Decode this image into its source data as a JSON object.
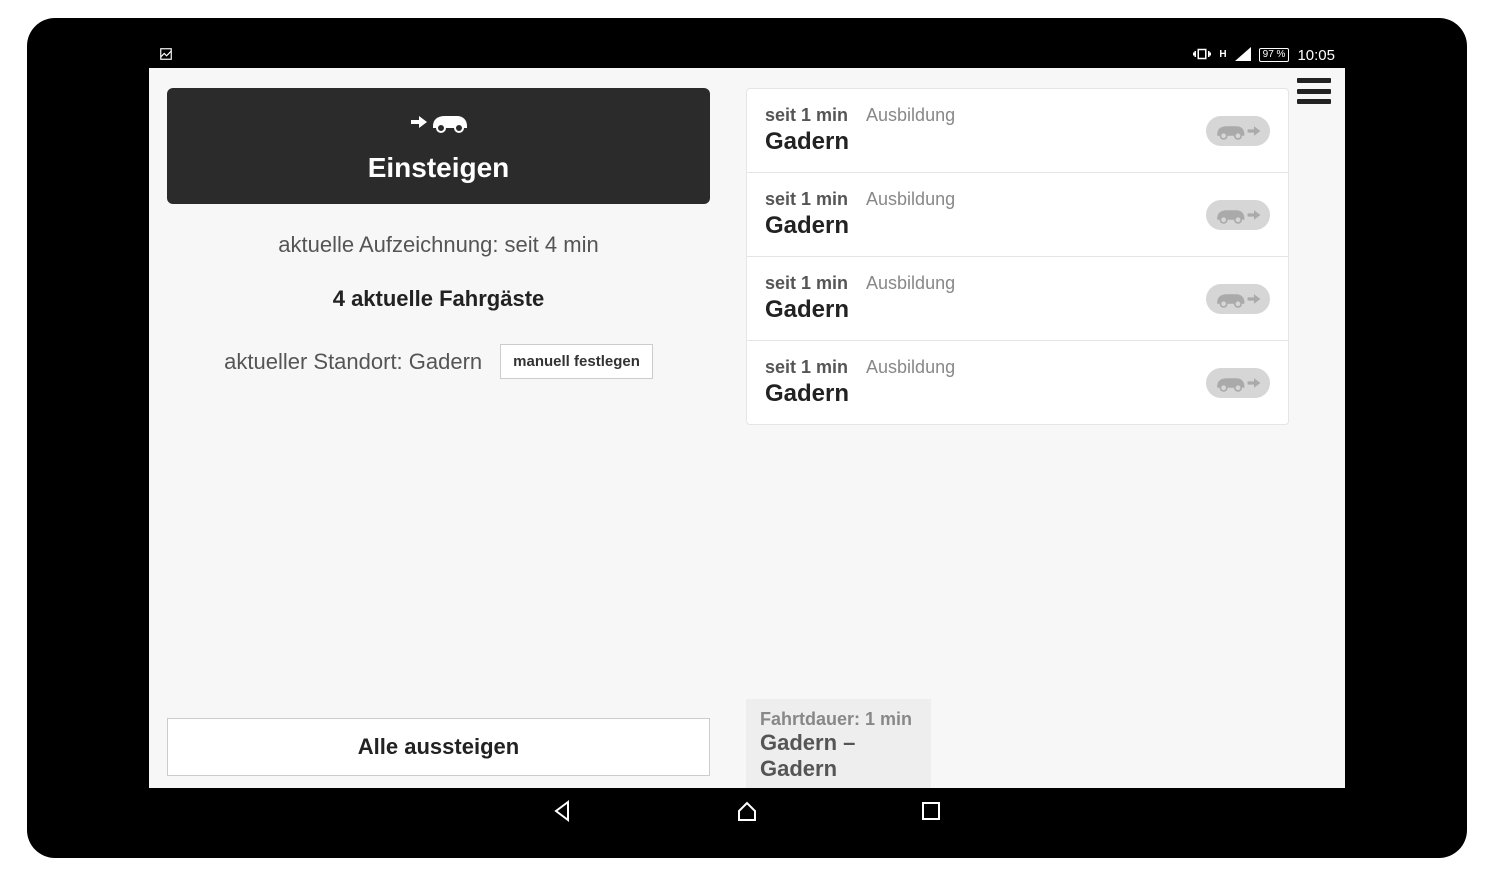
{
  "statusbar": {
    "battery": "97 %",
    "time": "10:05"
  },
  "left": {
    "einsteigen_label": "Einsteigen",
    "recording_line": "aktuelle Aufzeichnung: seit 4 min",
    "passengers_line": "4 aktuelle Fahrgäste",
    "location_line": "aktueller Standort: Gadern",
    "manual_set_label": "manuell festlegen",
    "all_exit_label": "Alle aussteigen"
  },
  "passengers": [
    {
      "duration": "seit 1 min",
      "category": "Ausbildung",
      "location": "Gadern"
    },
    {
      "duration": "seit 1 min",
      "category": "Ausbildung",
      "location": "Gadern"
    },
    {
      "duration": "seit 1 min",
      "category": "Ausbildung",
      "location": "Gadern"
    },
    {
      "duration": "seit 1 min",
      "category": "Ausbildung",
      "location": "Gadern"
    }
  ],
  "trip": {
    "duration_line": "Fahrtdauer: 1 min",
    "route": "Gadern – Gadern"
  }
}
